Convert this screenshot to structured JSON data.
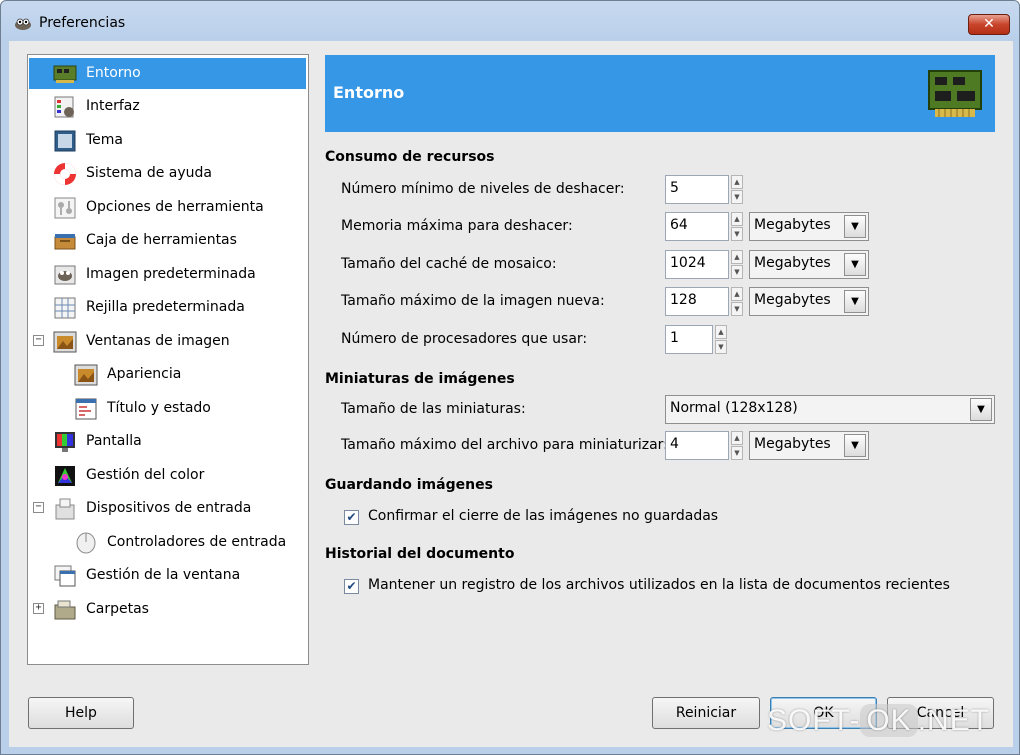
{
  "window": {
    "title": "Preferencias"
  },
  "sidebar": {
    "items": [
      {
        "label": "Entorno",
        "icon": "board-icon"
      },
      {
        "label": "Interfaz",
        "icon": "interface-icon"
      },
      {
        "label": "Tema",
        "icon": "theme-icon"
      },
      {
        "label": "Sistema de ayuda",
        "icon": "lifebuoy-icon"
      },
      {
        "label": "Opciones de herramienta",
        "icon": "tool-options-icon"
      },
      {
        "label": "Caja de herramientas",
        "icon": "toolbox-icon"
      },
      {
        "label": "Imagen predeterminada",
        "icon": "gimp-image-icon"
      },
      {
        "label": "Rejilla predeterminada",
        "icon": "grid-icon"
      },
      {
        "label": "Ventanas de imagen",
        "icon": "image-window-icon",
        "expander": "−"
      },
      {
        "label": "Apariencia",
        "icon": "appearance-icon"
      },
      {
        "label": "Título y estado",
        "icon": "title-status-icon"
      },
      {
        "label": "Pantalla",
        "icon": "display-icon"
      },
      {
        "label": "Gestión del color",
        "icon": "color-management-icon"
      },
      {
        "label": "Dispositivos de entrada",
        "icon": "input-devices-icon",
        "expander": "−"
      },
      {
        "label": "Controladores de entrada",
        "icon": "input-controllers-icon"
      },
      {
        "label": "Gestión de la ventana",
        "icon": "window-management-icon"
      },
      {
        "label": "Carpetas",
        "icon": "folders-icon",
        "expander": "+"
      }
    ]
  },
  "header": {
    "title": "Entorno"
  },
  "sections": {
    "resources": {
      "title": "Consumo de recursos",
      "min_undo_label": "Número mínimo de niveles de deshacer:",
      "min_undo_value": "5",
      "max_undo_mem_label": "Memoria máxima para deshacer:",
      "max_undo_mem_value": "64",
      "max_undo_mem_unit": "Megabytes",
      "tile_cache_label": "Tamaño del caché de mosaico:",
      "tile_cache_value": "1024",
      "tile_cache_unit": "Megabytes",
      "max_image_label": "Tamaño máximo de la imagen nueva:",
      "max_image_value": "128",
      "max_image_unit": "Megabytes",
      "processors_label": "Número de procesadores que usar:",
      "processors_value": "1"
    },
    "thumbnails": {
      "title": "Miniaturas de imágenes",
      "size_label": "Tamaño de las miniaturas:",
      "size_value": "Normal (128x128)",
      "max_file_label": "Tamaño máximo del archivo para miniaturizar:",
      "max_file_value": "4",
      "max_file_unit": "Megabytes"
    },
    "saving": {
      "title": "Guardando imágenes",
      "confirm_label": "Confirmar el cierre de las imágenes no guardadas",
      "confirm_checked": true
    },
    "history": {
      "title": "Historial del documento",
      "keep_label": "Mantener un registro de los archivos utilizados en la lista de documentos recientes",
      "keep_checked": true
    }
  },
  "buttons": {
    "help": "Help",
    "reset": "Reiniciar",
    "ok": "OK",
    "cancel": "Cancel"
  },
  "watermark": {
    "left": "SOFT-",
    "middle": "OK",
    "right": ".NET"
  },
  "colors": {
    "selection": "#3597e6",
    "header_band": "#3597e6",
    "dialog_bg": "#eaeaea"
  }
}
